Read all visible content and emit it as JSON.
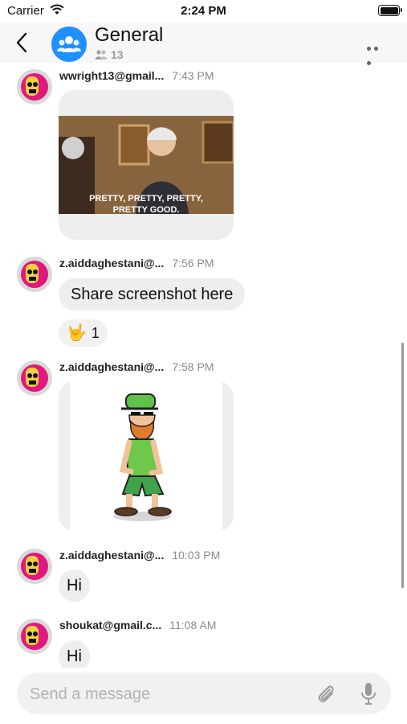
{
  "status_bar": {
    "carrier": "Carrier",
    "time": "2:24 PM"
  },
  "header": {
    "title": "General",
    "member_count": "13"
  },
  "messages": [
    {
      "user": "wwright13@gmail...",
      "time": "7:43 PM",
      "type": "image",
      "caption": "PRETTY, PRETTY, PRETTY,\nPRETTY GOOD."
    },
    {
      "user": "z.aiddaghestani@...",
      "time": "7:56 PM",
      "type": "text",
      "text": "Share screenshot here",
      "reaction": {
        "emoji": "🤟",
        "count": "1"
      }
    },
    {
      "user": "z.aiddaghestani@...",
      "time": "7:58 PM",
      "type": "sticker"
    },
    {
      "user": "z.aiddaghestani@...",
      "time": "10:03 PM",
      "type": "text",
      "text": "Hi"
    },
    {
      "user": "shoukat@gmail.c...",
      "time": "11:08 AM",
      "type": "text",
      "text": "Hi"
    }
  ],
  "composer": {
    "placeholder": "Send a message"
  },
  "colors": {
    "accent": "#1e90ff",
    "bubble": "#eeeeef"
  }
}
